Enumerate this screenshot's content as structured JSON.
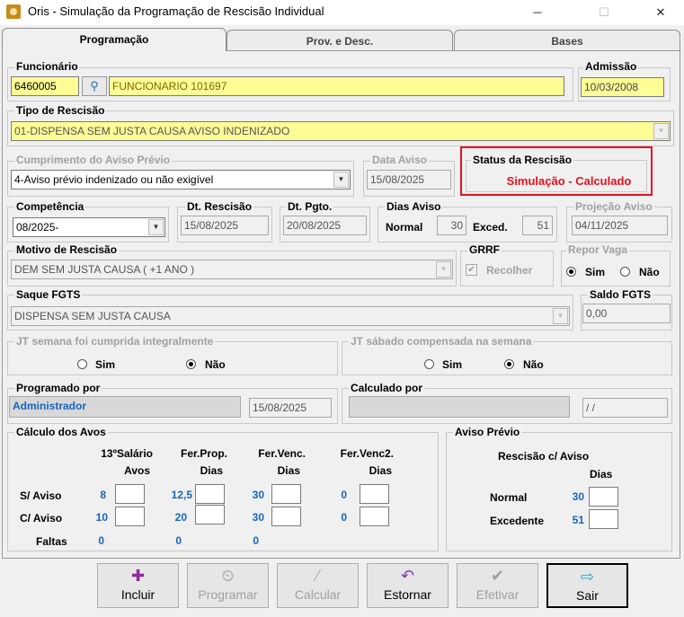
{
  "window": {
    "title": "Oris - Simulação da Programação de Rescisão Individual",
    "min": "─",
    "max": "☐",
    "close": "✕"
  },
  "tabs": [
    "Programação",
    "Prov. e Desc.",
    "Bases"
  ],
  "funcionario": {
    "label": "Funcionário",
    "code": "6460005",
    "name": "FUNCIONARIO 101697"
  },
  "admissao": {
    "label": "Admissão",
    "value": "10/03/2008"
  },
  "tipo_rescisao": {
    "label": "Tipo de Rescisão",
    "value": "01-DISPENSA SEM JUSTA CAUSA AVISO INDENIZADO"
  },
  "cumprimento": {
    "label": "Cumprimento do Aviso Prévio",
    "value": "4-Aviso prévio indenizado ou não exigível"
  },
  "data_aviso": {
    "label": "Data Aviso",
    "value": "15/08/2025"
  },
  "status": {
    "label": "Status da Rescisão",
    "value": "Simulação - Calculado",
    "color": "#e8101c"
  },
  "competencia": {
    "label": "Competência",
    "value": "08/2025-"
  },
  "dt_rescisao": {
    "label": "Dt. Rescisão",
    "value": "15/08/2025"
  },
  "dt_pgto": {
    "label": "Dt. Pgto.",
    "value": "20/08/2025"
  },
  "dias_aviso": {
    "label": "Dias Aviso",
    "normal_label": "Normal",
    "normal": "30",
    "exced_label": "Exced.",
    "exced": "51"
  },
  "projecao": {
    "label": "Projeção Aviso",
    "value": "04/11/2025"
  },
  "motivo": {
    "label": "Motivo de Rescisão",
    "value": "DEM SEM JUSTA CAUSA ( +1 ANO )"
  },
  "grrf": {
    "label": "GRRF",
    "check": "Recolher"
  },
  "repor": {
    "label": "Repor Vaga",
    "sim": "Sim",
    "nao": "Não"
  },
  "saque": {
    "label": "Saque FGTS",
    "value": "DISPENSA SEM JUSTA CAUSA"
  },
  "saldo": {
    "label": "Saldo FGTS",
    "value": "0,00"
  },
  "jt_semana": {
    "label": "JT semana foi cumprida integralmente",
    "sim": "Sim",
    "nao": "Não"
  },
  "jt_sabado": {
    "label": "JT sábado compensada na semana",
    "sim": "Sim",
    "nao": "Não"
  },
  "programado": {
    "label": "Programado por",
    "user": "Administrador",
    "date": "15/08/2025"
  },
  "calculado": {
    "label": "Calculado por",
    "date": " / /"
  },
  "calculo": {
    "label": "Cálculo dos Avos",
    "headers": [
      [
        "13ºSalário",
        "Avos"
      ],
      [
        "Fer.Prop.",
        "Dias"
      ],
      [
        "Fer.Venc.",
        "Dias"
      ],
      [
        "Fer.Venc2.",
        "Dias"
      ]
    ],
    "rows": [
      {
        "label": "S/ Aviso",
        "values": [
          "8",
          "12,5",
          "30",
          "0"
        ]
      },
      {
        "label": "C/ Aviso",
        "values": [
          "10",
          "20",
          "30",
          "0"
        ]
      },
      {
        "label": "Faltas",
        "values": [
          "0",
          "0",
          "0"
        ]
      }
    ]
  },
  "aviso_previo": {
    "label": "Aviso Prévio",
    "header1": "Rescisão c/ Aviso",
    "header2": "Dias",
    "normal_label": "Normal",
    "normal": "30",
    "exced_label": "Excedente",
    "exced": "51"
  },
  "buttons": [
    {
      "label": "Incluir",
      "icon": "✚",
      "color": "#8e2a9c"
    },
    {
      "label": "Programar",
      "icon": "⏲",
      "color": "#a0a0a0"
    },
    {
      "label": "Calcular",
      "icon": "⁄",
      "color": "#b0b0b0"
    },
    {
      "label": "Estornar",
      "icon": "↶",
      "color": "#7b3fb0"
    },
    {
      "label": "Efetivar",
      "icon": "✔",
      "color": "#a0a0a0"
    },
    {
      "label": "Sair",
      "icon": "⇨",
      "color": "#1aa7c9"
    }
  ]
}
